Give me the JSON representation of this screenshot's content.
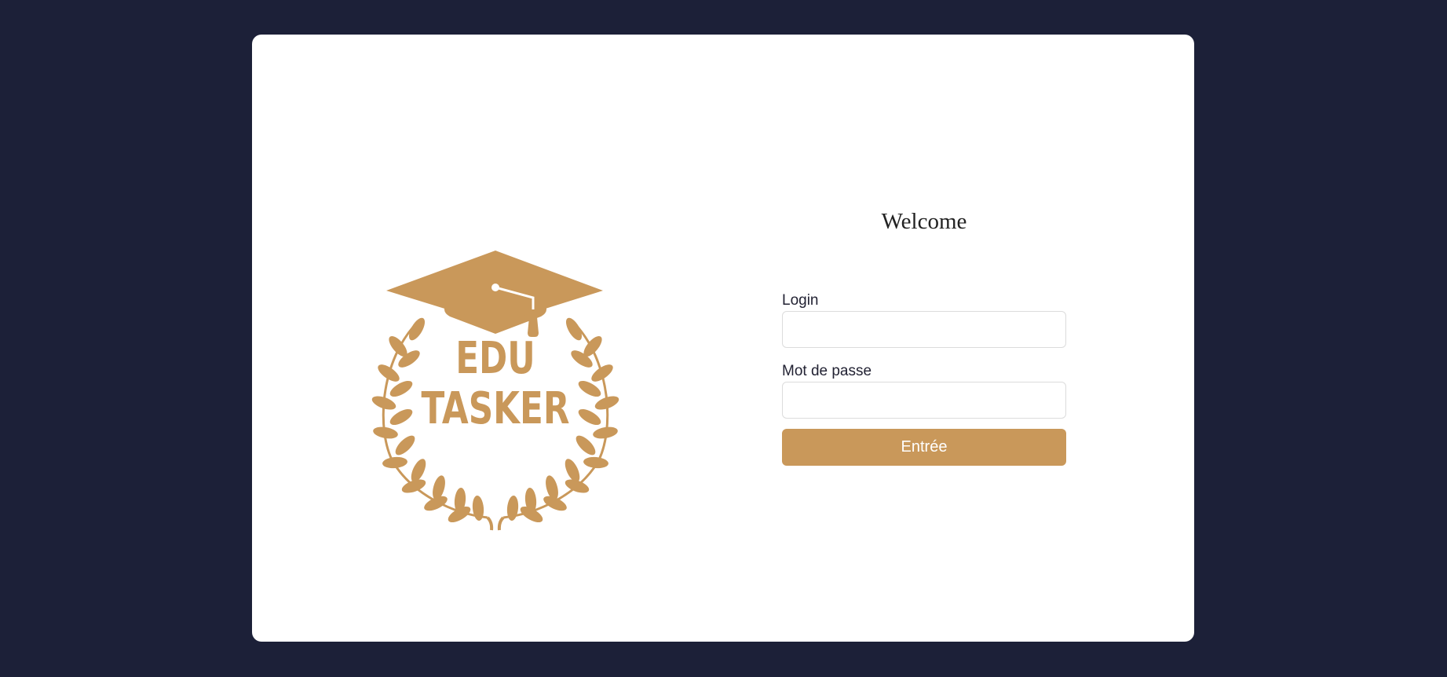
{
  "logo": {
    "line1": "EDU",
    "line2": "TASKER",
    "color": "#c9985a",
    "icons": [
      "graduation-cap-icon",
      "laurel-wreath-icon"
    ]
  },
  "login_form": {
    "heading": "Welcome",
    "login_label": "Login",
    "login_value": "",
    "password_label": "Mot de passe",
    "password_value": "",
    "submit_label": "Entrée"
  },
  "colors": {
    "background": "#1c2038",
    "card": "#ffffff",
    "accent": "#c9985a"
  }
}
